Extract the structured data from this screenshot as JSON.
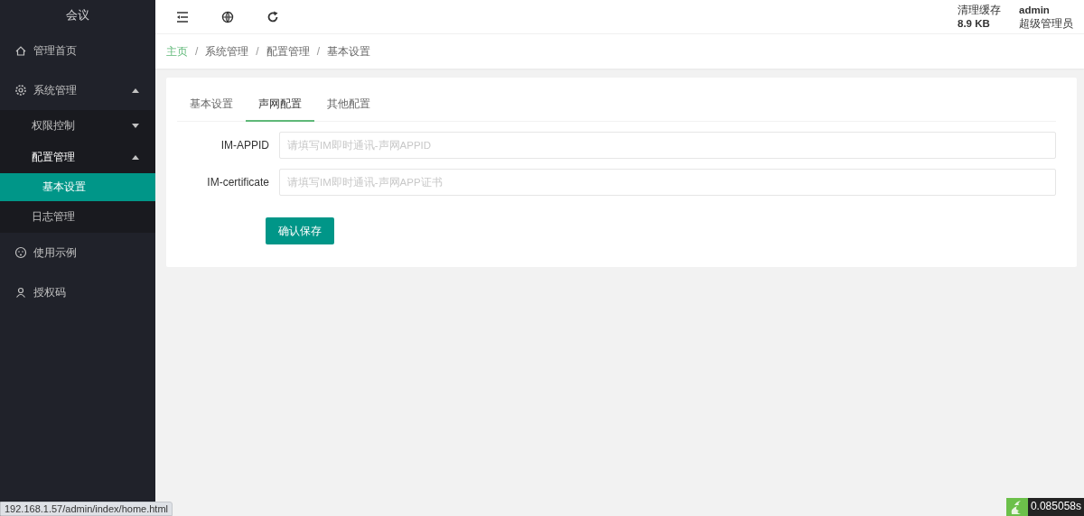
{
  "sidebar": {
    "title": "会议",
    "items": [
      {
        "label": "管理首页",
        "selected": false
      },
      {
        "label": "系统管理",
        "expanded": true,
        "selected": false,
        "children": [
          {
            "label": "权限控制",
            "expanded": false,
            "selected": false
          },
          {
            "label": "配置管理",
            "expanded": true,
            "selected": false,
            "children": [
              {
                "label": "基本设置",
                "selected": true
              }
            ]
          },
          {
            "label": "日志管理",
            "selected": false
          }
        ]
      },
      {
        "label": "使用示例",
        "selected": false
      },
      {
        "label": "授权码",
        "selected": false
      }
    ]
  },
  "header": {
    "cache_label": "清理缓存",
    "cache_size": "8.9 KB",
    "user": "admin",
    "role": "超级管理员"
  },
  "breadcrumb": [
    {
      "label": "主页"
    },
    {
      "separator": "/",
      "label": "系统管理"
    },
    {
      "separator": "/",
      "label": "配置管理"
    },
    {
      "separator": "/",
      "label": "基本设置"
    }
  ],
  "tabs": [
    {
      "label": "基本设置",
      "selected": false
    },
    {
      "label": "声网配置",
      "selected": true
    },
    {
      "label": "其他配置",
      "selected": false
    }
  ],
  "form": {
    "fields": [
      {
        "label": "IM-APPID",
        "placeholder": "请填写IM即时通讯-声网APPID"
      },
      {
        "label": "IM-certificate",
        "placeholder": "请填写IM即时通讯-声网APP证书"
      }
    ],
    "submit": "确认保存"
  },
  "status_url": "192.168.1.57/admin/index/home.html",
  "trace_time": "0.085058s"
}
